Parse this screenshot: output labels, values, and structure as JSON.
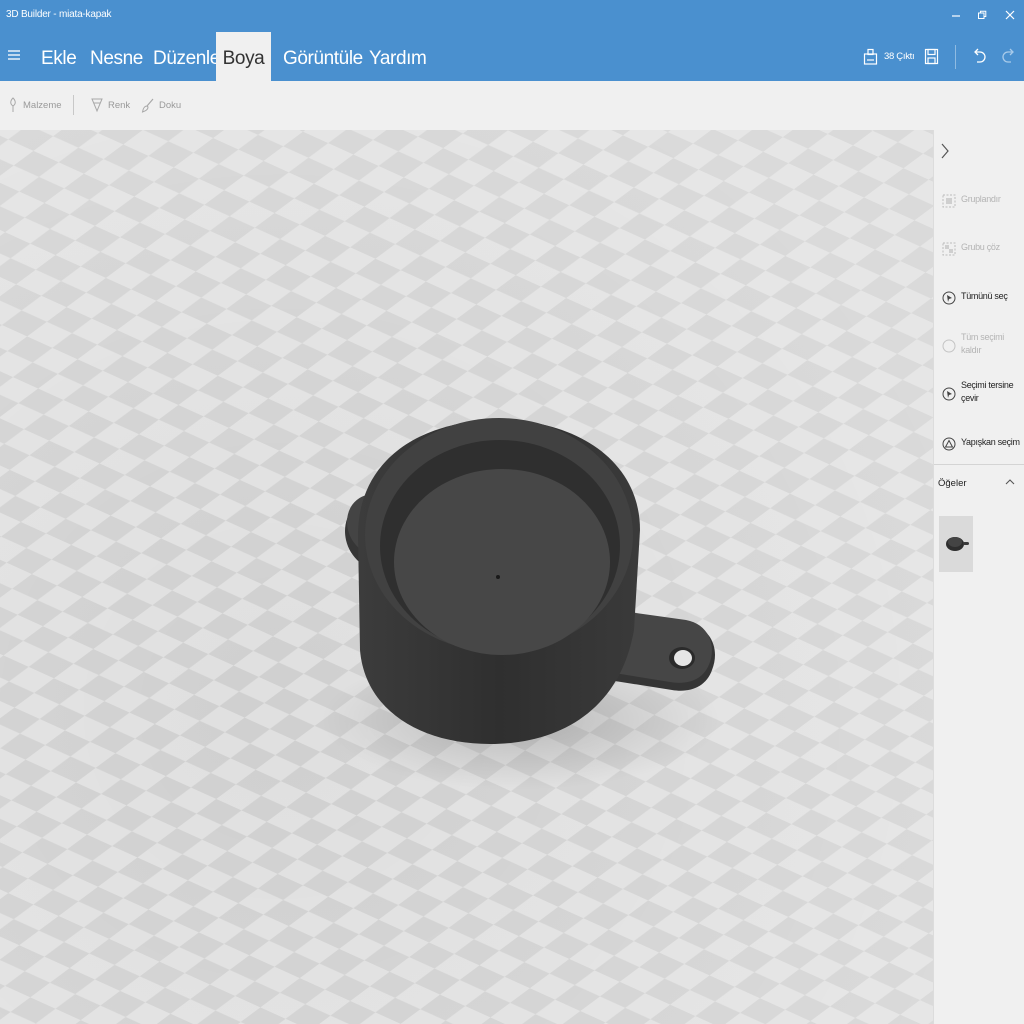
{
  "window": {
    "title": "3D Builder - miata-kapak",
    "minimize_icon": "minimize-icon",
    "maximize_icon": "restore-icon",
    "close_icon": "close-icon"
  },
  "menu": {
    "tabs": [
      {
        "label": "Ekle"
      },
      {
        "label": "Nesne"
      },
      {
        "label": "Düzenle"
      },
      {
        "label": "Boya",
        "active": true
      },
      {
        "label": "Görüntüle"
      },
      {
        "label": "Yardım"
      }
    ],
    "print_label": "38 Çıktı",
    "accent": "#4a90cf"
  },
  "toolbar": {
    "material_label": "Malzeme",
    "color_label": "Renk",
    "texture_label": "Doku"
  },
  "side_panel": {
    "items": [
      {
        "label": "Gruplandır",
        "enabled": false,
        "icon": "group-icon"
      },
      {
        "label": "Grubu çöz",
        "enabled": false,
        "icon": "ungroup-icon"
      },
      {
        "label": "Tümünü seç",
        "enabled": true,
        "icon": "select-all-icon"
      },
      {
        "label": "Tüm seçimi kaldır",
        "enabled": false,
        "icon": "deselect-icon"
      },
      {
        "label": "Seçimi tersine çevir",
        "enabled": true,
        "icon": "invert-selection-icon"
      },
      {
        "label": "Yapışkan seçim",
        "enabled": true,
        "icon": "sticky-selection-icon"
      }
    ],
    "section_title": "Öğeler"
  }
}
